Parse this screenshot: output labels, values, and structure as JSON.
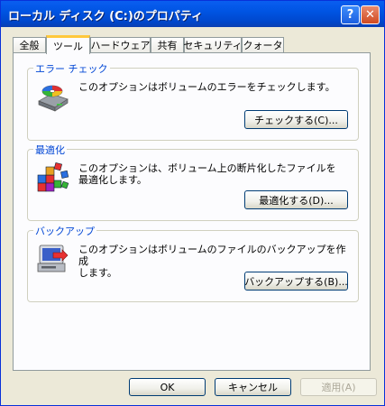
{
  "window": {
    "title": "ローカル ディスク (C:)のプロパティ"
  },
  "titlebar_buttons": {
    "help": "?",
    "close": "✕"
  },
  "tabs": [
    {
      "label": "全般"
    },
    {
      "label": "ツール"
    },
    {
      "label": "ハードウェア"
    },
    {
      "label": "共有"
    },
    {
      "label": "セキュリティ"
    },
    {
      "label": "クォータ"
    }
  ],
  "groups": {
    "error_check": {
      "label": "エラー チェック",
      "description": "このオプションはボリュームのエラーをチェックします。",
      "button": "チェックする(C)...",
      "icon": "disk-check-icon"
    },
    "defrag": {
      "label": "最適化",
      "description": "このオプションは、ボリューム上の断片化したファイルを\n最適化します。",
      "button": "最適化する(D)...",
      "icon": "defrag-icon"
    },
    "backup": {
      "label": "バックアップ",
      "description": "このオプションはボリュームのファイルのバックアップを作成\nします。",
      "button": "バックアップする(B)...",
      "icon": "backup-icon"
    }
  },
  "footer": {
    "ok": "OK",
    "cancel": "キャンセル",
    "apply": "適用(A)"
  },
  "colors": {
    "titlebar": "#0054e3",
    "group_label": "#0046d5",
    "dialog_bg": "#ece9d8",
    "active_tab_accent": "#ffc83c"
  }
}
